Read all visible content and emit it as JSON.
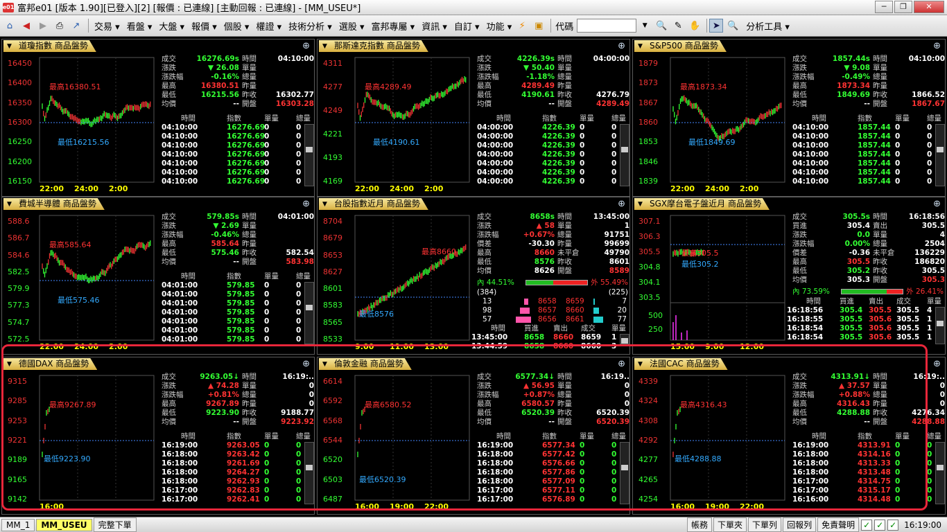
{
  "app": {
    "title": "富邦e01 [版本 1.90][已登入][2] [報價 : 已連線] [主動回報 : 已連線] - [MM_USEU*]",
    "logo_text": "e01",
    "window_controls": [
      "─",
      "❐",
      "✕"
    ]
  },
  "menu": [
    "交易",
    "看盤",
    "大盤",
    "報價",
    "個股",
    "權證",
    "技術分析",
    "選股",
    "富邦專屬",
    "資訊",
    "自訂",
    "功能"
  ],
  "toolbar_icons": {
    "home": "⌂",
    "back": "◀",
    "forward": "▶",
    "print": "⎙",
    "open": "↗",
    "flash": "⚡",
    "save": "▣",
    "search": "🔍",
    "tool1": "✎",
    "tool2": "✋",
    "cursor": "➤",
    "analysis": "🔍"
  },
  "code_label": "代碼",
  "analysis_tools": "分析工具",
  "status": {
    "tabs": [
      "MM_1",
      "MM_USEU",
      "完整下單"
    ],
    "right_buttons": [
      "帳務",
      "下單夾",
      "下單列",
      "回報列",
      "免責聲明"
    ],
    "time": "16:19:00"
  },
  "panels": [
    {
      "title": "道瓊指數 商品盤勢",
      "ticks": [
        "16450",
        "16400",
        "16350",
        "16300",
        "16250",
        "16200",
        "16150"
      ],
      "xticks": [
        "22:00",
        "24:00",
        "2:00"
      ],
      "high": "最高16380.51",
      "low": "最低16215.56",
      "info": [
        [
          "成交",
          "16276.69s",
          "時間",
          "04:10:00"
        ],
        [
          "漲跌",
          "▼ 26.08",
          "單量",
          ""
        ],
        [
          "漲跌幅",
          "-0.16%",
          "總量",
          ""
        ],
        [
          "最高",
          "16380.51",
          "昨量",
          ""
        ],
        [
          "最低",
          "16215.56",
          "昨收",
          "16302.77"
        ],
        [
          "均價",
          "--",
          "開盤",
          "16303.28"
        ]
      ],
      "thead": [
        "時間",
        "指數",
        "單量",
        "總量"
      ],
      "rows": [
        [
          "04:10:00",
          "16276.69",
          "0",
          "0"
        ],
        [
          "04:10:00",
          "16276.69",
          "0",
          "0"
        ],
        [
          "04:10:00",
          "16276.69",
          "0",
          "0"
        ],
        [
          "04:10:00",
          "16276.69",
          "0",
          "0"
        ],
        [
          "04:10:00",
          "16276.69",
          "0",
          "0"
        ],
        [
          "04:10:00",
          "16276.69",
          "0",
          "0"
        ],
        [
          "04:10:00",
          "16276.69",
          "0",
          "0"
        ]
      ]
    },
    {
      "title": "那斯達克指數 商品盤勢",
      "ticks": [
        "4311",
        "4277",
        "4249",
        "4221",
        "4193",
        "4169"
      ],
      "xticks": [
        "22:00",
        "24:00",
        "2:00"
      ],
      "high": "最高4289.49",
      "low": "最低4190.61",
      "info": [
        [
          "成交",
          "4226.39s",
          "時間",
          "04:00:00"
        ],
        [
          "漲跌",
          "▼ 50.40",
          "單量",
          ""
        ],
        [
          "漲跌幅",
          "-1.18%",
          "總量",
          ""
        ],
        [
          "最高",
          "4289.49",
          "昨量",
          ""
        ],
        [
          "最低",
          "4190.61",
          "昨收",
          "4276.79"
        ],
        [
          "均價",
          "--",
          "開盤",
          "4289.49"
        ]
      ],
      "thead": [
        "時間",
        "指數",
        "單量",
        "總量"
      ],
      "rows": [
        [
          "04:00:00",
          "4226.39",
          "0",
          "0"
        ],
        [
          "04:00:00",
          "4226.39",
          "0",
          "0"
        ],
        [
          "04:00:00",
          "4226.39",
          "0",
          "0"
        ],
        [
          "04:00:00",
          "4226.39",
          "0",
          "0"
        ],
        [
          "04:00:00",
          "4226.39",
          "0",
          "0"
        ],
        [
          "04:00:00",
          "4226.39",
          "0",
          "0"
        ],
        [
          "04:00:00",
          "4226.39",
          "0",
          "0"
        ]
      ]
    },
    {
      "title": "S&P500 商品盤勢",
      "ticks": [
        "1879",
        "1873",
        "1867",
        "1860",
        "1853",
        "1846",
        "1839"
      ],
      "xticks": [
        "22:00",
        "24:00",
        "2:00"
      ],
      "high": "最高1873.34",
      "low": "最低1849.69",
      "info": [
        [
          "成交",
          "1857.44s",
          "時間",
          "04:10:00"
        ],
        [
          "漲跌",
          "▼ 9.08",
          "單量",
          ""
        ],
        [
          "漲跌幅",
          "-0.49%",
          "總量",
          ""
        ],
        [
          "最高",
          "1873.34",
          "昨量",
          ""
        ],
        [
          "最低",
          "1849.69",
          "昨收",
          "1866.52"
        ],
        [
          "均價",
          "--",
          "開盤",
          "1867.67"
        ]
      ],
      "thead": [
        "時間",
        "指數",
        "單量",
        "總量"
      ],
      "rows": [
        [
          "04:10:00",
          "1857.44",
          "0",
          "0"
        ],
        [
          "04:10:00",
          "1857.44",
          "0",
          "0"
        ],
        [
          "04:10:00",
          "1857.44",
          "0",
          "0"
        ],
        [
          "04:10:00",
          "1857.44",
          "0",
          "0"
        ],
        [
          "04:10:00",
          "1857.44",
          "0",
          "0"
        ],
        [
          "04:10:00",
          "1857.44",
          "0",
          "0"
        ],
        [
          "04:10:00",
          "1857.44",
          "0",
          "0"
        ]
      ]
    },
    {
      "title": "費城半導體 商品盤勢",
      "ticks": [
        "588.6",
        "586.7",
        "584.6",
        "582.5",
        "579.9",
        "577.3",
        "574.7",
        "572.5"
      ],
      "xticks": [
        "22:00",
        "24:00",
        "2:00"
      ],
      "high": "最高585.64",
      "low": "最低575.46",
      "info": [
        [
          "成交",
          "579.85s",
          "時間",
          "04:01:00"
        ],
        [
          "漲跌",
          "▼ 2.69",
          "單量",
          ""
        ],
        [
          "漲跌幅",
          "-0.46%",
          "總量",
          ""
        ],
        [
          "最高",
          "585.64",
          "昨量",
          ""
        ],
        [
          "最低",
          "575.46",
          "昨收",
          "582.54"
        ],
        [
          "均價",
          "--",
          "開盤",
          "583.98"
        ]
      ],
      "thead": [
        "時間",
        "指數",
        "單量",
        "總量"
      ],
      "rows": [
        [
          "04:01:00",
          "579.85",
          "0",
          "0"
        ],
        [
          "04:01:00",
          "579.85",
          "0",
          "0"
        ],
        [
          "04:01:00",
          "579.85",
          "0",
          "0"
        ],
        [
          "04:01:00",
          "579.85",
          "0",
          "0"
        ],
        [
          "04:01:00",
          "579.85",
          "0",
          "0"
        ],
        [
          "04:01:00",
          "579.85",
          "0",
          "0"
        ],
        [
          "04:01:00",
          "579.85",
          "0",
          "0"
        ]
      ]
    },
    {
      "title": "台股指數近月 商品盤勢",
      "ticks": [
        "8704",
        "8679",
        "8653",
        "8627",
        "8601",
        "8583",
        "8565",
        "8533"
      ],
      "xticks": [
        "9:00",
        "11:00",
        "13:00"
      ],
      "high": "最高8660",
      "low": "最低8576",
      "info": [
        [
          "成交",
          "8658s",
          "時間",
          "13:45:00"
        ],
        [
          "漲跌",
          "▲ 58",
          "單量",
          "1"
        ],
        [
          "漲跌幅",
          "+0.67%",
          "總量",
          "91751"
        ],
        [
          "價差",
          "-30.30",
          "昨量",
          "99699"
        ],
        [
          "最高",
          "8660",
          "未平倉",
          "49790"
        ],
        [
          "最低",
          "8576",
          "昨收",
          "8601"
        ],
        [
          "均價",
          "8626",
          "開盤",
          "8589"
        ]
      ],
      "inner": [
        "內",
        "44.51%",
        "外",
        "55.49%"
      ],
      "bidask_counts": [
        "(384)",
        "(225)"
      ],
      "depth": [
        [
          "13",
          "8658",
          "8659",
          "7"
        ],
        [
          "98",
          "8657",
          "8660",
          "20"
        ],
        [
          "57",
          "8656",
          "8661",
          "77"
        ]
      ],
      "thead": [
        "時間",
        "買進",
        "賣出",
        "成交",
        "單量"
      ],
      "rows": [
        [
          "13:45:00",
          "8658",
          "8660",
          "8659",
          "1"
        ],
        [
          "13:44:59",
          "8658",
          "8660",
          "8660",
          "3"
        ]
      ]
    },
    {
      "title": "SGX摩台電子盤近月 商品盤勢",
      "ticks": [
        "307.1",
        "306.3",
        "305.5",
        "304.8",
        "304.1",
        "303.5"
      ],
      "vticks": [
        "500",
        "250"
      ],
      "xticks": [
        "15:00",
        "9:00",
        "12:00"
      ],
      "high": "最高305.5",
      "low": "最低305.2",
      "info": [
        [
          "成交",
          "305.5s",
          "時間",
          "16:18:56"
        ],
        [
          "買進",
          "305.4",
          "賣出",
          "305.5"
        ],
        [
          "漲跌",
          "0.0",
          "單量",
          "4"
        ],
        [
          "漲跌幅",
          "0.00%",
          "總量",
          "2504"
        ],
        [
          "價差",
          "-0.36",
          "未平倉",
          "136229"
        ],
        [
          "最高",
          "305.5",
          "昨收",
          "186820"
        ],
        [
          "最低",
          "305.2",
          "昨收",
          "305.5"
        ],
        [
          "均價",
          "305.3",
          "開盤",
          "305.3"
        ]
      ],
      "inner": [
        "內",
        "73.59%",
        "外",
        "26.41%"
      ],
      "thead": [
        "時間",
        "買進",
        "賣出",
        "成交",
        "單量"
      ],
      "rows": [
        [
          "16:18:56",
          "305.4",
          "305.5",
          "305.5",
          "4"
        ],
        [
          "16:18:55",
          "305.5",
          "305.6",
          "305.5",
          "1"
        ],
        [
          "16:18:54",
          "305.5",
          "305.6",
          "305.5",
          "1"
        ],
        [
          "16:18:54",
          "305.5",
          "305.6",
          "305.5",
          "1"
        ]
      ]
    },
    {
      "title": "德國DAX 商品盤勢",
      "ticks": [
        "9315",
        "9285",
        "9253",
        "9221",
        "9189",
        "9165",
        "9142"
      ],
      "xticks": [
        "16:00",
        "",
        "",
        ""
      ],
      "high": "最高9267.89",
      "low": "最低9223.90",
      "info": [
        [
          "成交",
          "9263.05↓",
          "時間",
          "16:19:.."
        ],
        [
          "漲跌",
          "▲ 74.28",
          "單量",
          "0"
        ],
        [
          "漲跌幅",
          "+0.81%",
          "總量",
          "0"
        ],
        [
          "最高",
          "9267.89",
          "昨量",
          "0"
        ],
        [
          "最低",
          "9223.90",
          "昨收",
          "9188.77"
        ],
        [
          "均價",
          "--",
          "開盤",
          "9223.92"
        ]
      ],
      "thead": [
        "時間",
        "指數",
        "單量",
        "總量"
      ],
      "rows": [
        [
          "16:19:00",
          "9263.05",
          "0",
          "0"
        ],
        [
          "16:18:00",
          "9263.42",
          "0",
          "0"
        ],
        [
          "16:18:00",
          "9261.69",
          "0",
          "0"
        ],
        [
          "16:18:00",
          "9264.27",
          "0",
          "0"
        ],
        [
          "16:18:00",
          "9262.93",
          "0",
          "0"
        ],
        [
          "16:17:00",
          "9262.83",
          "0",
          "0"
        ],
        [
          "16:17:00",
          "9262.41",
          "0",
          "0"
        ]
      ]
    },
    {
      "title": "倫敦金融 商品盤勢",
      "ticks": [
        "6614",
        "6592",
        "6568",
        "6544",
        "6520",
        "6503",
        "6487"
      ],
      "xticks": [
        "16:00",
        "19:00",
        "22:00"
      ],
      "high": "最高6580.52",
      "low": "最低6520.39",
      "info": [
        [
          "成交",
          "6577.34↓",
          "時間",
          "16:19.."
        ],
        [
          "漲跌",
          "▲ 56.95",
          "單量",
          "0"
        ],
        [
          "漲跌幅",
          "+0.87%",
          "總量",
          "0"
        ],
        [
          "最高",
          "6580.57",
          "昨量",
          "0"
        ],
        [
          "最低",
          "6520.39",
          "昨收",
          "6520.39"
        ],
        [
          "均價",
          "--",
          "開盤",
          "6520.39"
        ]
      ],
      "thead": [
        "時間",
        "指數",
        "單量",
        "總量"
      ],
      "rows": [
        [
          "16:19:00",
          "6577.34",
          "0",
          "0"
        ],
        [
          "16:18:00",
          "6577.42",
          "0",
          "0"
        ],
        [
          "16:18:00",
          "6576.66",
          "0",
          "0"
        ],
        [
          "16:18:00",
          "6577.86",
          "0",
          "0"
        ],
        [
          "16:18:00",
          "6577.09",
          "0",
          "0"
        ],
        [
          "16:17:00",
          "6577.11",
          "0",
          "0"
        ],
        [
          "16:17:00",
          "6576.89",
          "0",
          "0"
        ]
      ]
    },
    {
      "title": "法國CAC 商品盤勢",
      "ticks": [
        "4339",
        "4324",
        "4308",
        "4292",
        "4277",
        "4265",
        "4254"
      ],
      "xticks": [
        "16:00",
        "19:00",
        "22:00"
      ],
      "high": "最高4316.43",
      "low": "最低4288.88",
      "info": [
        [
          "成交",
          "4313.91↓",
          "時間",
          "16:19:.."
        ],
        [
          "漲跌",
          "▲ 37.57",
          "單量",
          "0"
        ],
        [
          "漲跌幅",
          "+0.88%",
          "總量",
          "0"
        ],
        [
          "最高",
          "4316.43",
          "昨量",
          "0"
        ],
        [
          "最低",
          "4288.88",
          "昨收",
          "4276.34"
        ],
        [
          "均價",
          "--",
          "開盤",
          "4288.88"
        ]
      ],
      "thead": [
        "時間",
        "指數",
        "單量",
        "總量"
      ],
      "rows": [
        [
          "16:19:00",
          "4313.91",
          "0",
          "0"
        ],
        [
          "16:18:00",
          "4314.16",
          "0",
          "0"
        ],
        [
          "16:18:00",
          "4313.33",
          "0",
          "0"
        ],
        [
          "16:18:00",
          "4313.48",
          "0",
          "0"
        ],
        [
          "16:17:00",
          "4314.75",
          "0",
          "0"
        ],
        [
          "16:17:00",
          "4315.17",
          "0",
          "0"
        ],
        [
          "16:16:00",
          "4314.48",
          "0",
          "0"
        ]
      ]
    }
  ]
}
